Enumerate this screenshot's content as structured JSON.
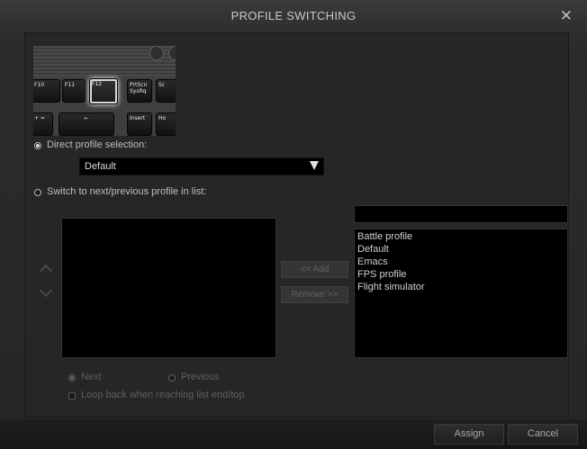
{
  "dialog": {
    "title": "PROFILE SWITCHING",
    "close_glyph": "✕"
  },
  "keyboard": {
    "keys": [
      "F10",
      "F11",
      "F12",
      "PrtScn SysRq",
      "Sc",
      "+ =",
      "←",
      "Insert",
      "Ho"
    ],
    "highlighted_key": "F12"
  },
  "direct": {
    "label": "Direct profile selection:",
    "selected": true
  },
  "dropdown": {
    "value": "Default"
  },
  "switch": {
    "label": "Switch to next/previous profile in list:",
    "selected": false
  },
  "buttons": {
    "add": "<< Add",
    "remove": "Remove >>",
    "assign": "Assign",
    "cancel": "Cancel"
  },
  "available_profiles": [
    "Battle profile",
    "Default",
    "Emacs",
    "FPS profile",
    "Flight simulator"
  ],
  "options": {
    "next": "Next",
    "previous": "Previous",
    "loop": "Loop back when reaching list end/top"
  },
  "colors": {
    "background": "#262626",
    "list_bg": "#000000",
    "text": "#cfcfcf",
    "disabled_text": "#5f5f5f"
  }
}
